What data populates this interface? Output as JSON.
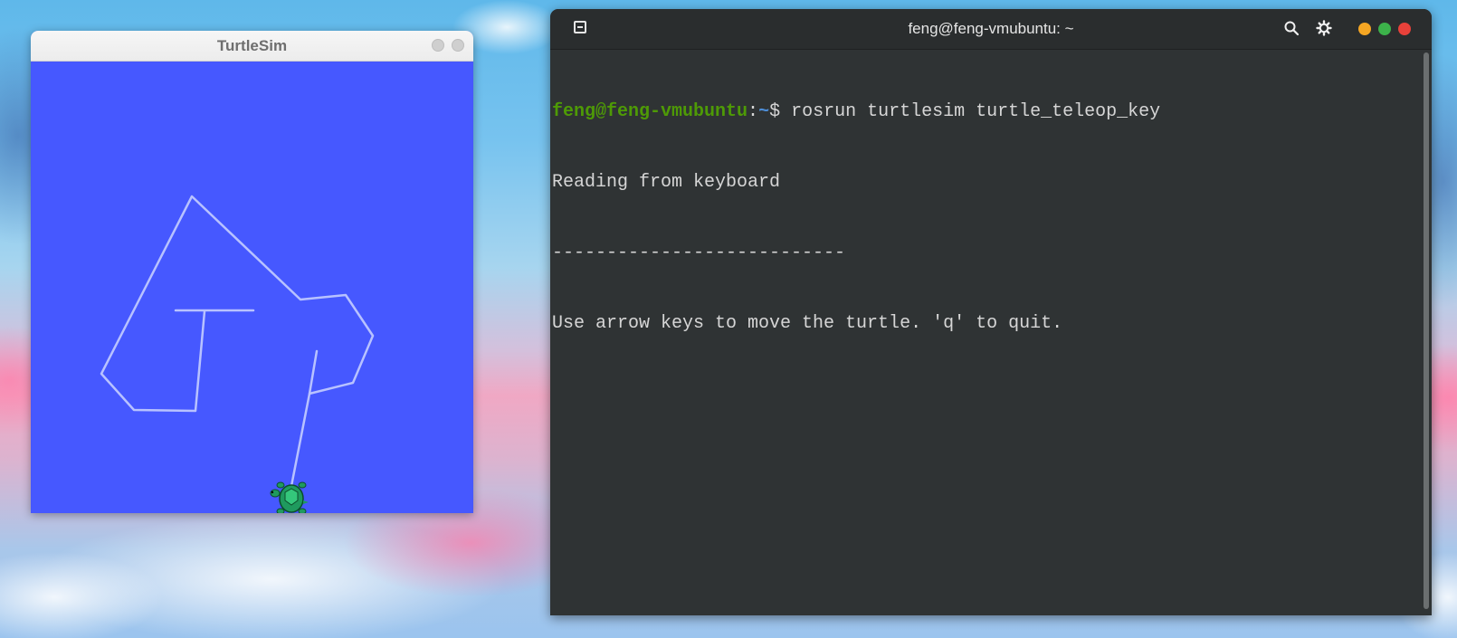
{
  "turtlesim": {
    "title": "TurtleSim",
    "background_color": "#4658ff",
    "trail_color": "#b8c2ff",
    "turtle_icon": "turtle-sprite-icon"
  },
  "terminal": {
    "title": "feng@feng-vmubuntu: ~",
    "prompt_user": "feng@feng-vmubuntu",
    "prompt_sep": ":",
    "prompt_path": "~",
    "prompt_symbol": "$ ",
    "command": "rosrun turtlesim turtle_teleop_key",
    "output_lines": [
      "Reading from keyboard",
      "---------------------------",
      "Use arrow keys to move the turtle. 'q' to quit."
    ],
    "icons": {
      "new_tab": "new-tab-icon",
      "search": "search-icon",
      "settings": "gear-icon"
    },
    "window_buttons": {
      "minimize_color": "#f5a623",
      "maximize_color": "#3cb24a",
      "close_color": "#e8413a"
    }
  }
}
